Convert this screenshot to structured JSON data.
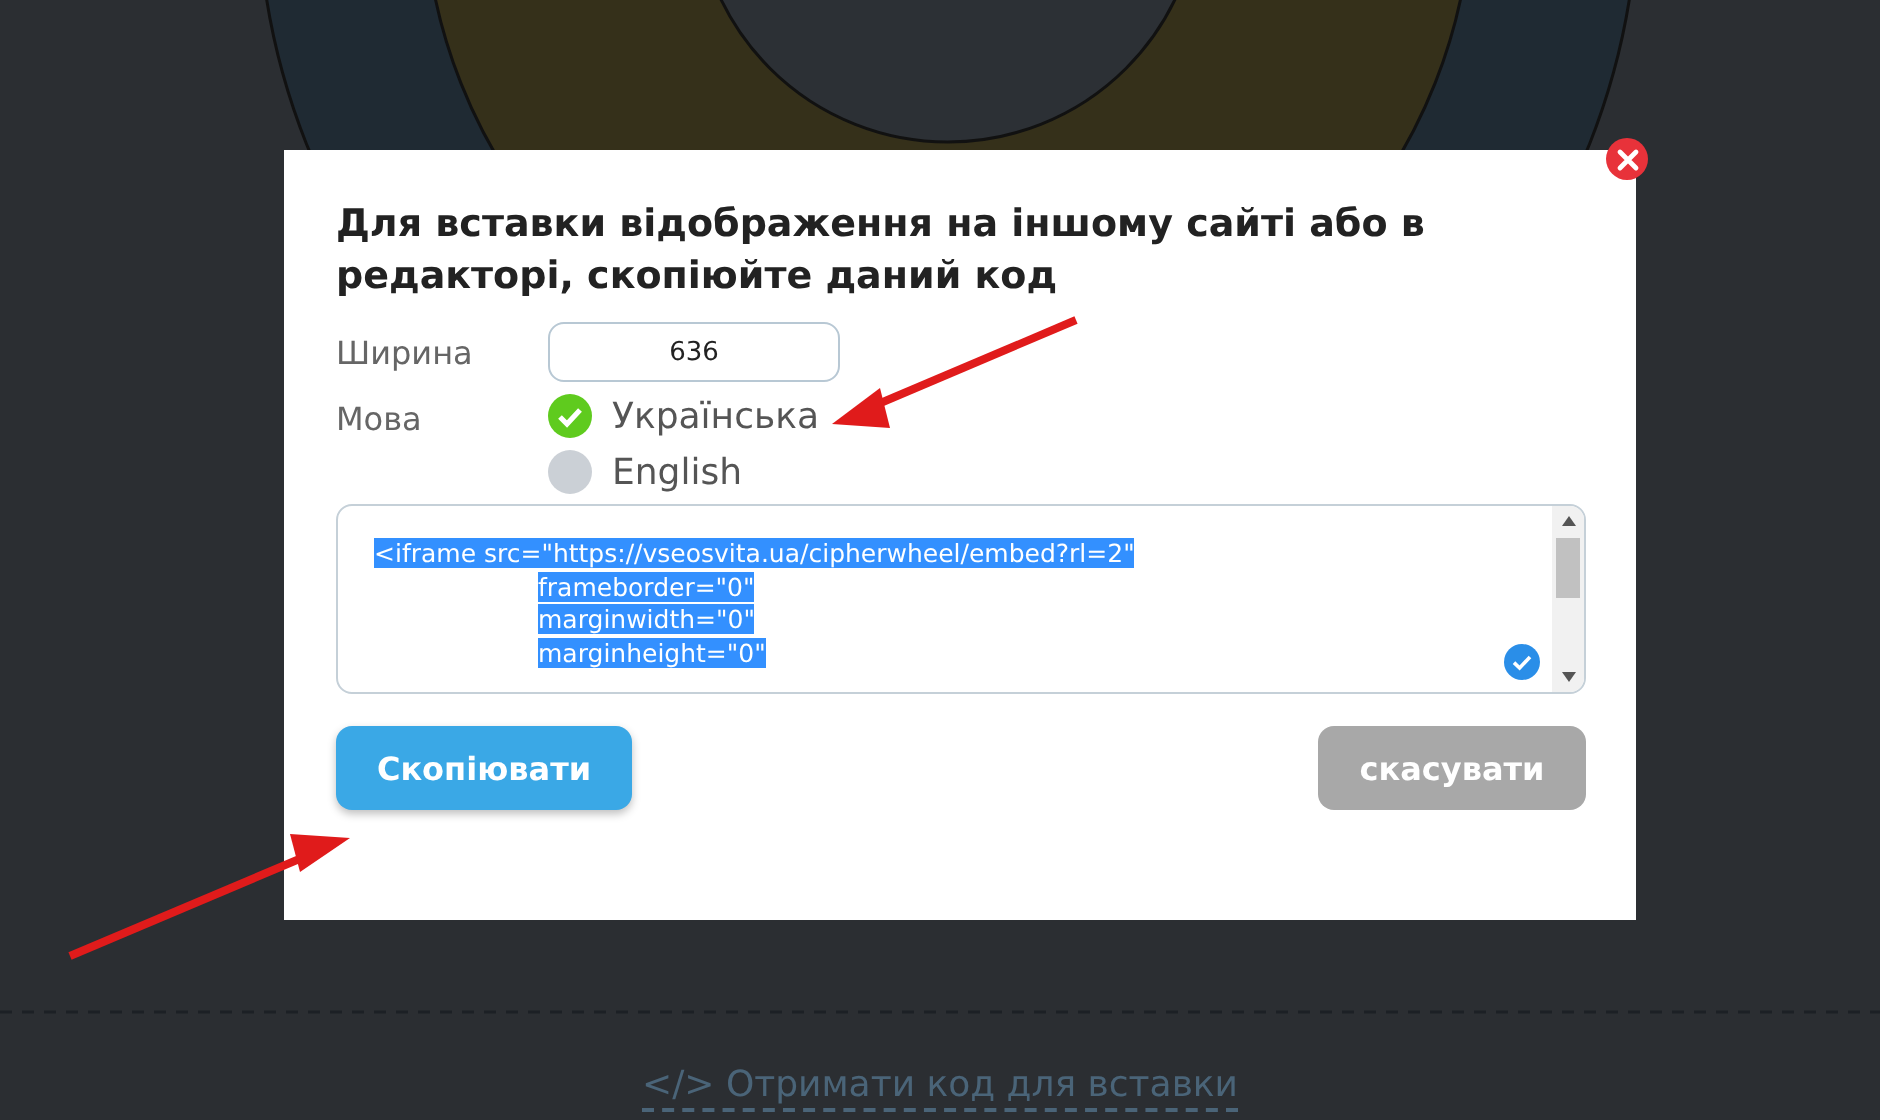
{
  "dialog": {
    "title": "Для вставки відображення на іншому сайті або в редакторі, скопіюйте даний код",
    "width": {
      "label": "Ширина",
      "value": "636"
    },
    "language": {
      "label": "Мова",
      "options": [
        {
          "label": "Українська",
          "selected": true
        },
        {
          "label": "English",
          "selected": false
        }
      ]
    },
    "code": {
      "selected": true,
      "lines": [
        "<iframe src=\"https://vseosvita.ua/cipherwheel/embed?rl=2\"",
        "frameborder=\"0\"",
        "marginwidth=\"0\"",
        "marginheight=\"0\""
      ]
    },
    "buttons": [
      {
        "label": "Скопіювати",
        "kind": "primary"
      },
      {
        "label": "скасувати",
        "kind": "secondary"
      }
    ]
  },
  "footer_link": "</> Отримати код для вставки"
}
